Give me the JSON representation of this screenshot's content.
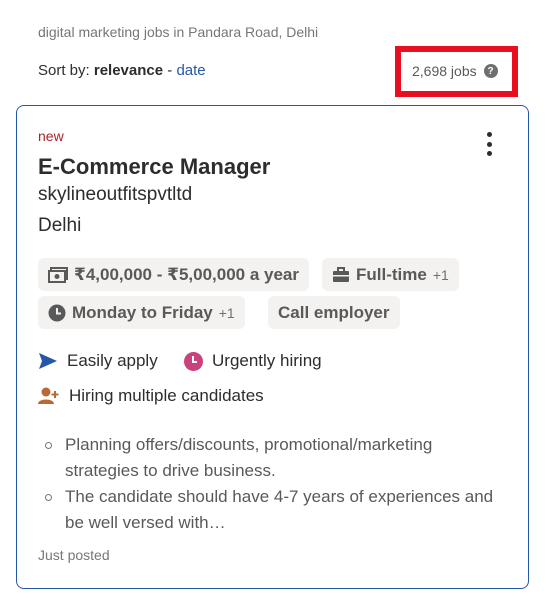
{
  "search": {
    "query_text": "digital marketing jobs in Pandara Road, Delhi"
  },
  "sort": {
    "label": "Sort by:",
    "active": "relevance",
    "separator": "-",
    "alternate": "date"
  },
  "results": {
    "count_text": "2,698 jobs",
    "help_glyph": "?"
  },
  "job": {
    "badge": "new",
    "title": "E-Commerce Manager",
    "company": "skylineoutfitspvtltd",
    "location": "Delhi",
    "chips": {
      "salary": "₹4,00,000 - ₹5,00,000 a year",
      "job_type": "Full-time",
      "job_type_more": "+1",
      "schedule": "Monday to Friday",
      "schedule_more": "+1",
      "contact": "Call employer"
    },
    "attributes": {
      "apply": "Easily apply",
      "urgent": "Urgently hiring",
      "multiple": "Hiring multiple candidates"
    },
    "snippet": [
      "Planning offers/discounts, promotional/marketing strategies to drive business.",
      "The candidate should have 4-7 years of experiences and be well versed with…"
    ],
    "posted": "Just posted"
  },
  "colors": {
    "accent_blue": "#2557a7",
    "new_red": "#a9252b",
    "highlight_red": "#e8101e",
    "urgent_pink": "#c9427e",
    "multiple_brown": "#b86a35"
  },
  "icons": {
    "help": "help-icon",
    "menu": "more-vertical-icon",
    "salary": "money-icon",
    "job_type": "briefcase-icon",
    "schedule": "clock-icon",
    "apply": "send-icon",
    "urgent": "clock-icon",
    "multiple": "person-add-icon"
  }
}
